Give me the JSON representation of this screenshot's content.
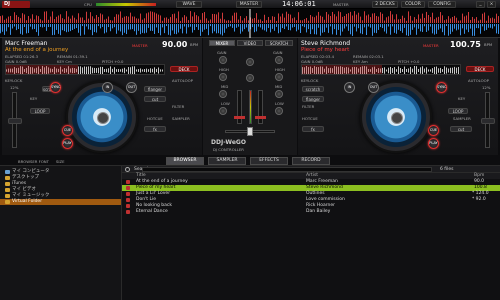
{
  "app": {
    "logo": "DJ"
  },
  "topbar": {
    "cpu_label": "CPU",
    "mode_buttons": [
      "WAVE",
      "MASTER"
    ],
    "clock": "14:06:01",
    "deck_buttons": [
      "2 DECKS",
      "COLOR",
      "CONFIG"
    ],
    "master_label": "MASTER",
    "colors": {
      "accent": "#8a1414",
      "selected_row": "#8cbf20",
      "folder": "#d6a430"
    }
  },
  "deck_left": {
    "artist": "Marc Freeman",
    "title": "At the end of a journey",
    "master_label": "MASTER",
    "bpm": "90.00",
    "bpm_unit": "BPM",
    "elapsed_label": "ELAPSED 01:26.3",
    "remain_label": "REMAIN 01:39.1",
    "gain_label": "GAIN 0.0dB",
    "key_label": "KEY Cm",
    "pitch_label": "PITCH +0.0",
    "deck_button": "DECK",
    "keylock": "KEYLOCK",
    "autoloop": "AUTOLOOP",
    "pitch_percent": "12%",
    "key": "KEY",
    "filter": "FILTER",
    "sampler": "SAMPLER",
    "hotcue": "HOTCUE",
    "pad_labels": [
      "scratch",
      "flanger",
      "cut",
      "fx"
    ],
    "button_labels": [
      "CUE",
      "PLAY",
      "SYNC",
      "IN",
      "OUT",
      "LOOP"
    ]
  },
  "deck_right": {
    "artist": "Steve Richmond",
    "title": "Piece of my heart",
    "master_label": "MASTER",
    "bpm": "100.75",
    "bpm_unit": "BPM",
    "elapsed_label": "ELAPSED 02:03.4",
    "remain_label": "REMAIN 02:03.1",
    "gain_label": "GAIN 0.0dB",
    "key_label": "KEY Am",
    "pitch_label": "PITCH +0.0",
    "deck_button": "DECK",
    "keylock": "KEYLOCK",
    "autoloop": "AUTOLOOP",
    "pitch_percent": "12%",
    "key": "KEY",
    "filter": "FILTER",
    "sampler": "SAMPLER",
    "hotcue": "HOTCUE",
    "pad_labels": [
      "scratch",
      "flanger",
      "cut",
      "fx"
    ],
    "button_labels": [
      "CUE",
      "PLAY",
      "SYNC",
      "IN",
      "OUT",
      "LOOP"
    ]
  },
  "mixer": {
    "tabs": [
      "MIXER",
      "VIDEO",
      "SCRATCH"
    ],
    "knob_labels": [
      "GAIN",
      "HIGH",
      "MID",
      "LOW"
    ],
    "brand": "DDJ-WeGO",
    "brand_sub": "DJ CONTROLLER"
  },
  "tabs": {
    "browser_font": "BROWSER FONT",
    "size": "SIZE",
    "items": [
      "BROWSER",
      "SAMPLER",
      "EFFECTS",
      "RECORD"
    ]
  },
  "tree": {
    "items": [
      "マイ コンピュータ",
      "デスクトップ",
      "iTunes",
      "マイ ビデオ",
      "マイ ミュージック",
      "Virtual Folder"
    ],
    "selected_index": 5
  },
  "browser": {
    "search_label": "Search",
    "file_count": "6 files",
    "columns": [
      "Title",
      "Artist",
      "Bpm"
    ],
    "rows": [
      {
        "title": "At the end of a journey",
        "artist": "Marc Freeman",
        "bpm": "90.0"
      },
      {
        "title": "Piece of my heart",
        "artist": "Steve Richmond",
        "bpm": "100.8"
      },
      {
        "title": "Just a Lil' Lover",
        "artist": "Outlines",
        "bpm": "* 124.0"
      },
      {
        "title": "Don't Lie",
        "artist": "Love commission",
        "bpm": "* 92.0"
      },
      {
        "title": "No looking back",
        "artist": "Rick Hoarner",
        "bpm": ""
      },
      {
        "title": "Eternal Dance",
        "artist": "Dan Bailey",
        "bpm": ""
      }
    ],
    "selected_index": 1
  }
}
